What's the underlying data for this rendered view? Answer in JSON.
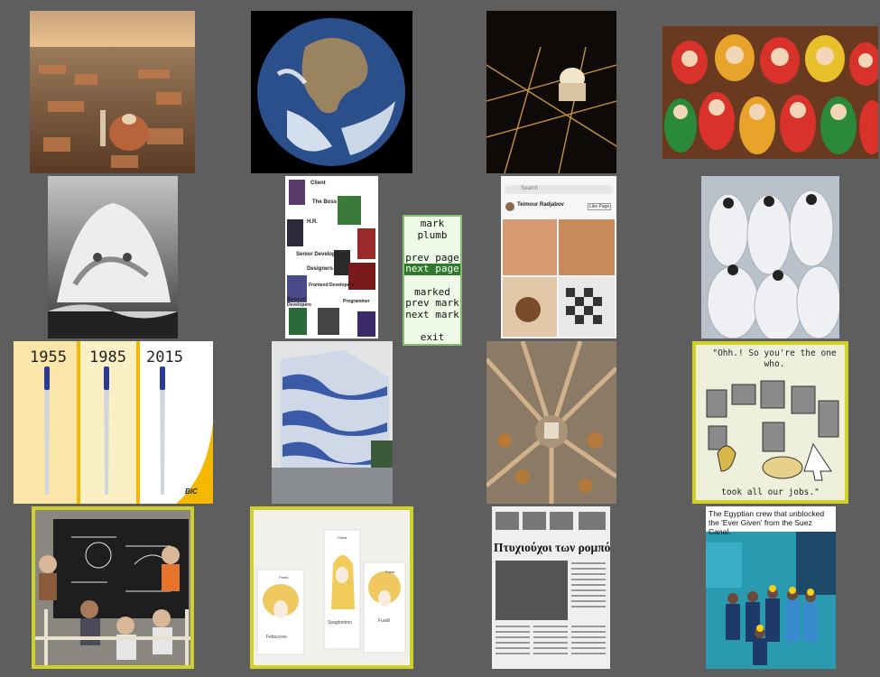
{
  "menu": {
    "items": [
      {
        "label": "mark"
      },
      {
        "label": "plumb"
      },
      {
        "label": "prev page"
      },
      {
        "label": "next page"
      },
      {
        "label": "marked"
      },
      {
        "label": "prev mark"
      },
      {
        "label": "next mark"
      },
      {
        "label": "exit"
      }
    ],
    "selected": "next page"
  },
  "thumbnails": [
    {
      "subject": "florence-aerial-sunset",
      "marked": false
    },
    {
      "subject": "earth-from-space",
      "marked": false
    },
    {
      "subject": "florence-night",
      "marked": false
    },
    {
      "subject": "matryoshka-dolls",
      "marked": false
    },
    {
      "subject": "wave-face",
      "marked": false
    },
    {
      "subject": "avengers-meme",
      "marked": false,
      "labels": [
        "Client",
        "The Boss",
        "H.R.",
        "Senior Developers",
        "Designers",
        "Frontend Developers",
        "Backend Developers",
        "Programmer"
      ]
    },
    {
      "subject": "phone-comic",
      "marked": false,
      "labels": [
        "Search",
        "Teimour Radjabov",
        "Like Page"
      ]
    },
    {
      "subject": "hazmat-workers",
      "marked": false
    },
    {
      "subject": "bic-pens",
      "marked": false,
      "labels": [
        "1955",
        "1985",
        "2015",
        "BIC"
      ]
    },
    {
      "subject": "wavy-building",
      "marked": false
    },
    {
      "subject": "arc-de-triomphe-aerial",
      "marked": false
    },
    {
      "subject": "robots-cartoon",
      "marked": true,
      "labels": [
        "\"Ohh.! So you're the one who.",
        "took all our jobs.\""
      ]
    },
    {
      "subject": "knitted-scientists",
      "marked": true
    },
    {
      "subject": "pasta-boxes",
      "marked": true,
      "labels": [
        "Pasta",
        "Fettuccine",
        "Pasta",
        "Spaghettoni",
        "Pasta",
        "Fusilli"
      ]
    },
    {
      "subject": "greek-newspaper",
      "marked": false,
      "labels": [
        "Πτυχιούχοι των ρομπότ"
      ]
    },
    {
      "subject": "suez-crew",
      "marked": false,
      "labels": [
        "The Egyptian crew that unblocked the 'Ever Given' from the Suez Canal."
      ]
    }
  ]
}
